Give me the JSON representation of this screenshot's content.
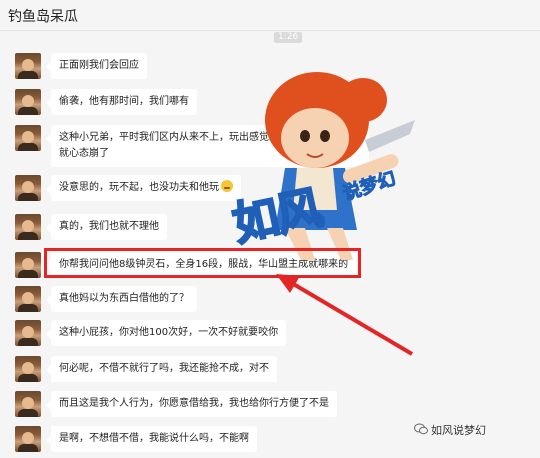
{
  "header": {
    "title": "钓鱼岛呆瓜"
  },
  "timestamp": "1:26",
  "messages": [
    {
      "text": "正面刚我们会回应"
    },
    {
      "text": "偷袭，他有那时间，我们哪有"
    },
    {
      "text": "这种小兄弟，平时我们区内从来不上，玩出感觉来了，结果输个帮战就心态崩了"
    },
    {
      "text": "没意思的，玩不起，也没功夫和他玩"
    },
    {
      "text": "真的，我们也就不理他"
    },
    {
      "text": "你帮我问问他8级钟灵石，全身16段，服战，华山盟主成就哪来的"
    },
    {
      "text": "真他妈以为东西白借他的了？"
    },
    {
      "text": "这种小屁孩，你对他100次好，一次不好就要咬你"
    },
    {
      "text": "何必呢，不借不就行了吗，我还能抢不成，对不"
    },
    {
      "text": "而且这是我个人行为，你愿意借给我，我也给你行方便了不是"
    },
    {
      "text": "是啊，不想借不借，我能说什么吗，不能啊"
    }
  ],
  "watermark": {
    "main": "如风",
    "sub": "说梦幻"
  },
  "brand": {
    "label": "如风说梦幻"
  },
  "colors": {
    "highlight": "#e32525",
    "bubble": "#ffffff",
    "background": "#f5f5f5"
  },
  "icons": {
    "emoji": "grimace-emoji-icon",
    "brand": "wechat-icon"
  }
}
